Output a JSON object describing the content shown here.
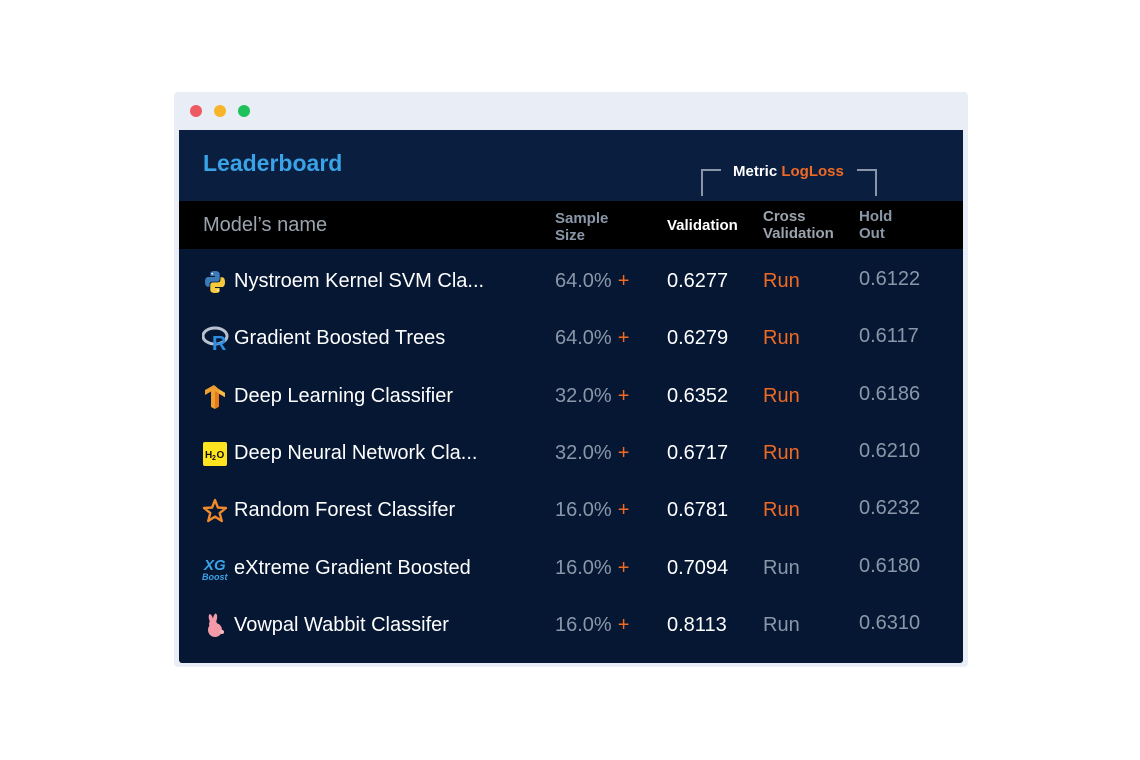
{
  "window": {
    "title": "Leaderboard",
    "metric_label": "Metric",
    "metric_value": "LogLoss"
  },
  "colors": {
    "title": "#3aa2e6",
    "accent": "#f06a23",
    "run_active": "#f06a23",
    "run_inactive": "#8a97a8",
    "panel_bg": "#061733",
    "header_bg": "#0a1e3f"
  },
  "table": {
    "headers": {
      "name": "Model’s name",
      "sample_line1": "Sample",
      "sample_line2": "Size",
      "validation": "Validation",
      "cross_line1": "Cross",
      "cross_line2": "Validation",
      "hold_line1": "Hold",
      "hold_line2": "Out"
    },
    "rows": [
      {
        "icon": "python-icon",
        "name": "Nystroem Kernel SVM Cla...",
        "sample": "64.0%",
        "plus": "+",
        "validation": "0.6277",
        "cross": "Run",
        "cross_active": true,
        "holdout": "0.6122"
      },
      {
        "icon": "r-language-icon",
        "name": "Gradient Boosted Trees",
        "sample": "64.0%",
        "plus": "+",
        "validation": "0.6279",
        "cross": "Run",
        "cross_active": true,
        "holdout": "0.6117"
      },
      {
        "icon": "tensorflow-icon",
        "name": "Deep Learning Classifier",
        "sample": "32.0%",
        "plus": "+",
        "validation": "0.6352",
        "cross": "Run",
        "cross_active": true,
        "holdout": "0.6186"
      },
      {
        "icon": "h2o-icon",
        "name": "Deep Neural Network Cla...",
        "sample": "32.0%",
        "plus": "+",
        "validation": "0.6717",
        "cross": "Run",
        "cross_active": true,
        "holdout": "0.6210"
      },
      {
        "icon": "star-icon",
        "name": "Random Forest Classifer",
        "sample": "16.0%",
        "plus": "+",
        "validation": "0.6781",
        "cross": "Run",
        "cross_active": true,
        "holdout": "0.6232"
      },
      {
        "icon": "xgboost-icon",
        "name": "eXtreme Gradient Boosted",
        "sample": "16.0%",
        "plus": "+",
        "validation": "0.7094",
        "cross": "Run",
        "cross_active": false,
        "holdout": "0.6180"
      },
      {
        "icon": "rabbit-icon",
        "name": "Vowpal Wabbit Classifer",
        "sample": "16.0%",
        "plus": "+",
        "validation": "0.8113",
        "cross": "Run",
        "cross_active": false,
        "holdout": "0.6310"
      }
    ]
  }
}
